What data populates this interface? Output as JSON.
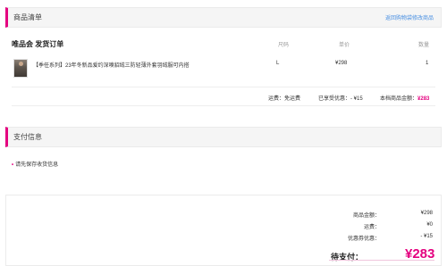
{
  "product_section": {
    "title": "商品清单",
    "back_link": "返回购物袋修改商品"
  },
  "order": {
    "shop_title": "唯品会 发货订单",
    "col_size": "尺码",
    "col_price": "单价",
    "col_qty": "数量",
    "item": {
      "name": "【季任系列】23年冬新品爱约深嗅貂绒三防轻薄外套羽绒服可内搭",
      "size": "L",
      "price": "¥298",
      "qty": "1"
    },
    "shipping_label": "运费：",
    "shipping_value": "免运费",
    "discount_label": "已享受优惠：",
    "discount_value": "- ¥15",
    "goods_amount_label": "本档商品金额：",
    "goods_amount_value": "¥283"
  },
  "payment_section": {
    "title": "支付信息",
    "tip": "请先保存收货信息"
  },
  "summary": {
    "rows": [
      {
        "label": "商品金额：",
        "value": "¥298"
      },
      {
        "label": "运费：",
        "value": "¥0"
      },
      {
        "label": "优惠券优惠：",
        "value": "- ¥15"
      }
    ],
    "total_label": "待支付：",
    "total_value": "¥283"
  },
  "colors": {
    "accent": "#e4007f",
    "link": "#4a90e2"
  }
}
